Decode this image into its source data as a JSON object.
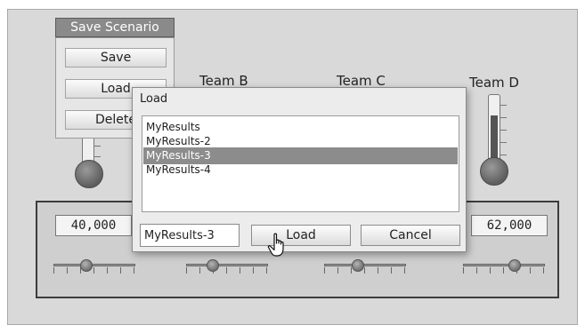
{
  "save_menu": {
    "title": "Save Scenario",
    "items": [
      "Save",
      "Load",
      "Delete"
    ]
  },
  "teams": [
    "Team B",
    "Team C",
    "Team D"
  ],
  "thermometers": [
    {
      "fill_fraction": 0.0
    },
    {
      "fill_fraction": 0.7
    }
  ],
  "values": [
    "40,000",
    "62,000"
  ],
  "sliders": [
    0.38,
    0.3,
    0.4,
    0.65
  ],
  "dialog": {
    "title": "Load",
    "files": [
      "MyResults",
      "MyResults-2",
      "MyResults-3",
      "MyResults-4"
    ],
    "selected": "MyResults-3",
    "filename_value": "MyResults-3",
    "load_label": "Load",
    "cancel_label": "Cancel"
  }
}
